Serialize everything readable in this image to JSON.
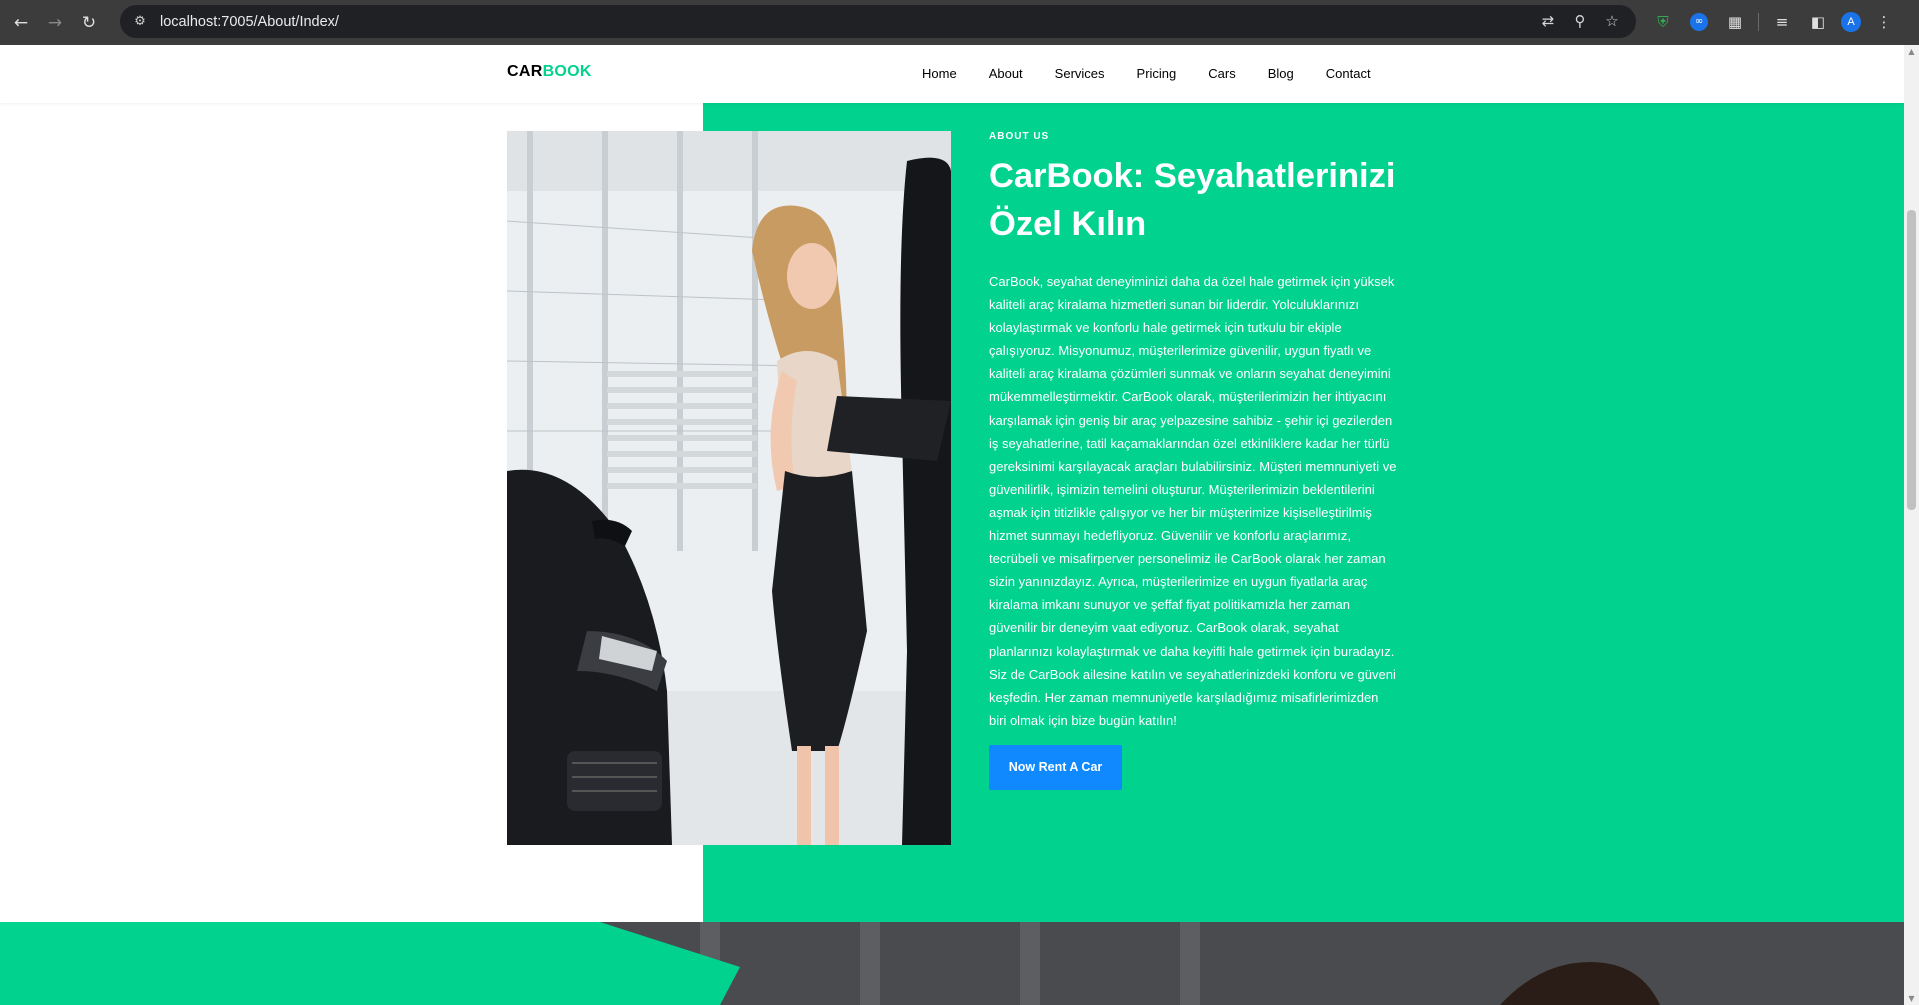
{
  "browser": {
    "url": "localhost:7005/About/Index/",
    "avatar_letter": "A"
  },
  "navbar": {
    "logo_part1": "CAR",
    "logo_part2": "BOOK",
    "items": [
      {
        "label": "Home"
      },
      {
        "label": "About"
      },
      {
        "label": "Services"
      },
      {
        "label": "Pricing"
      },
      {
        "label": "Cars"
      },
      {
        "label": "Blog"
      },
      {
        "label": "Contact"
      }
    ]
  },
  "about": {
    "subheading": "ABOUT US",
    "heading_line1": "CarBook: Seyahatlerinizi",
    "heading_line2": "Özel Kılın",
    "body": "CarBook, seyahat deneyiminizi daha da özel hale getirmek için yüksek kaliteli araç kiralama hizmetleri sunan bir liderdir. Yolculuklarınızı kolaylaştırmak ve konforlu hale getirmek için tutkulu bir ekiple çalışıyoruz. Misyonumuz, müşterilerimize güvenilir, uygun fiyatlı ve kaliteli araç kiralama çözümleri sunmak ve onların seyahat deneyimini mükemmelleştirmektir. CarBook olarak, müşterilerimizin her ihtiyacını karşılamak için geniş bir araç yelpazesine sahibiz - şehir içi gezilerden iş seyahatlerine, tatil kaçamaklarından özel etkinliklere kadar her türlü gereksinimi karşılayacak araçları bulabilirsiniz. Müşteri memnuniyeti ve güvenilirlik, işimizin temelini oluşturur. Müşterilerimizin beklentilerini aşmak için titizlikle çalışıyor ve her bir müşterimize kişiselleştirilmiş hizmet sunmayı hedefliyoruz. Güvenilir ve konforlu araçlarımız, tecrübeli ve misafirperver personelimiz ile CarBook olarak her zaman sizin yanınızdayız. Ayrıca, müşterilerimize en uygun fiyatlarla araç kiralama imkanı sunuyor ve şeffaf fiyat politikamızla her zaman güvenilir bir deneyim vaat ediyoruz. CarBook olarak, seyahat planlarınızı kolaylaştırmak ve daha keyifli hale getirmek için buradayız. Siz de CarBook ailesine katılın ve seyahatlerinizdeki konforu ve güveni keşfedin. Her zaman memnuniyetle karşıladığımız misafirlerimizden biri olmak için bize bugün katılın!",
    "cta_label": "Now Rent A Car"
  },
  "colors": {
    "accent_green": "#01d28e",
    "cta_blue": "#1089ff"
  }
}
